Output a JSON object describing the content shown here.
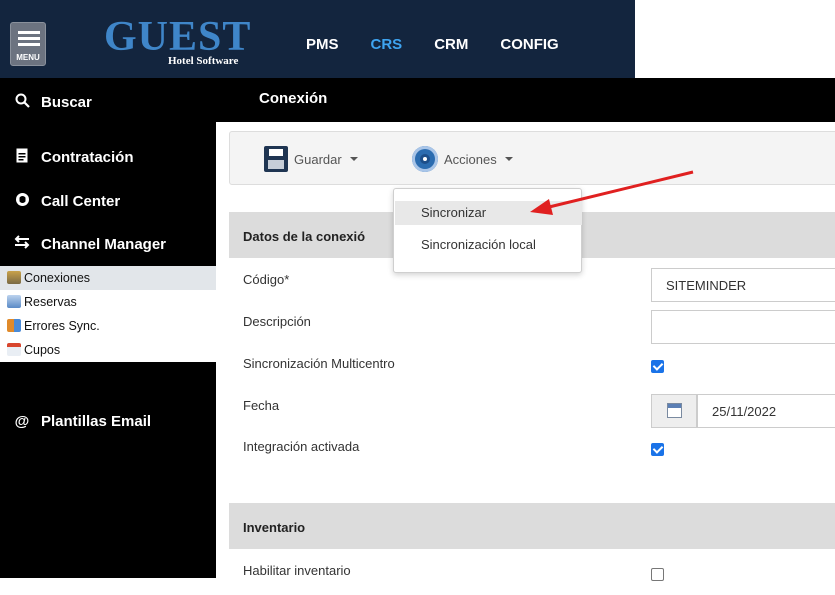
{
  "header": {
    "menu_label": "MENU",
    "logo_main": "GUEST",
    "logo_sub": "Hotel Software",
    "nav": [
      {
        "label": "PMS",
        "active": false
      },
      {
        "label": "CRS",
        "active": true
      },
      {
        "label": "CRM",
        "active": false
      },
      {
        "label": "CONFIG",
        "active": false
      }
    ],
    "active_color": "#3ea4f0"
  },
  "sidebar": {
    "search_label": "Buscar",
    "items": [
      {
        "label": "Contratación",
        "icon": "contract-icon"
      },
      {
        "label": "Call Center",
        "icon": "headset-icon"
      },
      {
        "label": "Channel Manager",
        "icon": "exchange-arrows-icon"
      }
    ],
    "subitems": [
      {
        "label": "Conexiones",
        "icon": "plug-icon",
        "active": true
      },
      {
        "label": "Reservas",
        "icon": "reservations-icon",
        "active": false
      },
      {
        "label": "Errores Sync.",
        "icon": "sync-error-icon",
        "active": false
      },
      {
        "label": "Cupos",
        "icon": "calendar-grid-icon",
        "active": false
      }
    ],
    "templates_label": "Plantillas Email"
  },
  "page": {
    "title": "Conexión"
  },
  "toolbar": {
    "save_label": "Guardar",
    "actions_label": "Acciones"
  },
  "actions_menu": {
    "items": [
      {
        "label": "Sincronizar",
        "highlighted": true
      },
      {
        "label": "Sincronización local",
        "highlighted": false
      }
    ]
  },
  "connection_section": {
    "title": "Datos de la conexió",
    "fields": {
      "codigo_label": "Código*",
      "codigo_value": "SITEMINDER",
      "descripcion_label": "Descripción",
      "descripcion_value": "",
      "multicentro_label": "Sincronización Multicentro",
      "multicentro_checked": true,
      "fecha_label": "Fecha",
      "fecha_value": "25/11/2022",
      "integracion_label": "Integración activada",
      "integracion_checked": true
    }
  },
  "inventory_section": {
    "title": "Inventario",
    "habilitar_label": "Habilitar inventario",
    "habilitar_checked": false
  },
  "annotation": {
    "arrow_color": "#e02020"
  }
}
